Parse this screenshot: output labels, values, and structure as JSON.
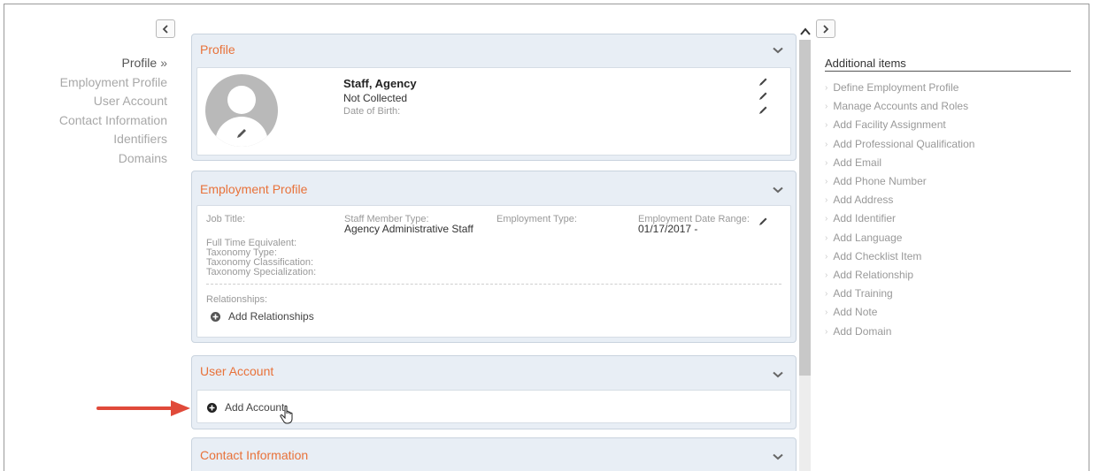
{
  "left_nav": {
    "items": [
      {
        "label": "Profile",
        "suffix": "»",
        "active": true
      },
      {
        "label": "Employment Profile",
        "active": false
      },
      {
        "label": "User Account",
        "active": false
      },
      {
        "label": "Contact Information",
        "active": false
      },
      {
        "label": "Identifiers",
        "active": false
      },
      {
        "label": "Domains",
        "active": false
      }
    ]
  },
  "profile": {
    "title": "Profile",
    "name": "Staff, Agency",
    "collected": "Not Collected",
    "dob_label": "Date of Birth:"
  },
  "employment": {
    "title": "Employment Profile",
    "job_title_label": "Job Title:",
    "staff_type_label": "Staff Member Type:",
    "staff_type_value": "Agency Administrative Staff",
    "employment_type_label": "Employment Type:",
    "date_range_label": "Employment Date Range:",
    "date_range_value": "01/17/2017 -",
    "fte_label": "Full Time Equivalent:",
    "taxonomy_type_label": "Taxonomy Type:",
    "taxonomy_class_label": "Taxonomy Classification:",
    "taxonomy_spec_label": "Taxonomy Specialization:",
    "relationships_label": "Relationships:",
    "add_relationships": "Add Relationships"
  },
  "user_account": {
    "title": "User Account",
    "add_account": "Add Account"
  },
  "contact": {
    "title": "Contact Information"
  },
  "right_panel": {
    "title": "Additional items",
    "items": [
      "Define Employment Profile",
      "Manage Accounts and Roles",
      "Add Facility Assignment",
      "Add Professional Qualification",
      "Add Email",
      "Add Phone Number",
      "Add Address",
      "Add Identifier",
      "Add Language",
      "Add Checklist Item",
      "Add Relationship",
      "Add Training",
      "Add Note",
      "Add Domain"
    ]
  },
  "colors": {
    "accent": "#e8723a",
    "panel_bg": "#e8eef5",
    "annotation_arrow": "#e04a3a"
  },
  "icons": {
    "left_collapse": "chevron-left-icon",
    "right_expand": "chevron-right-icon",
    "panel_toggle": "chevron-down-icon",
    "edit": "pencil-icon",
    "add": "plus-circle-icon",
    "cursor": "hand-cursor-icon"
  }
}
